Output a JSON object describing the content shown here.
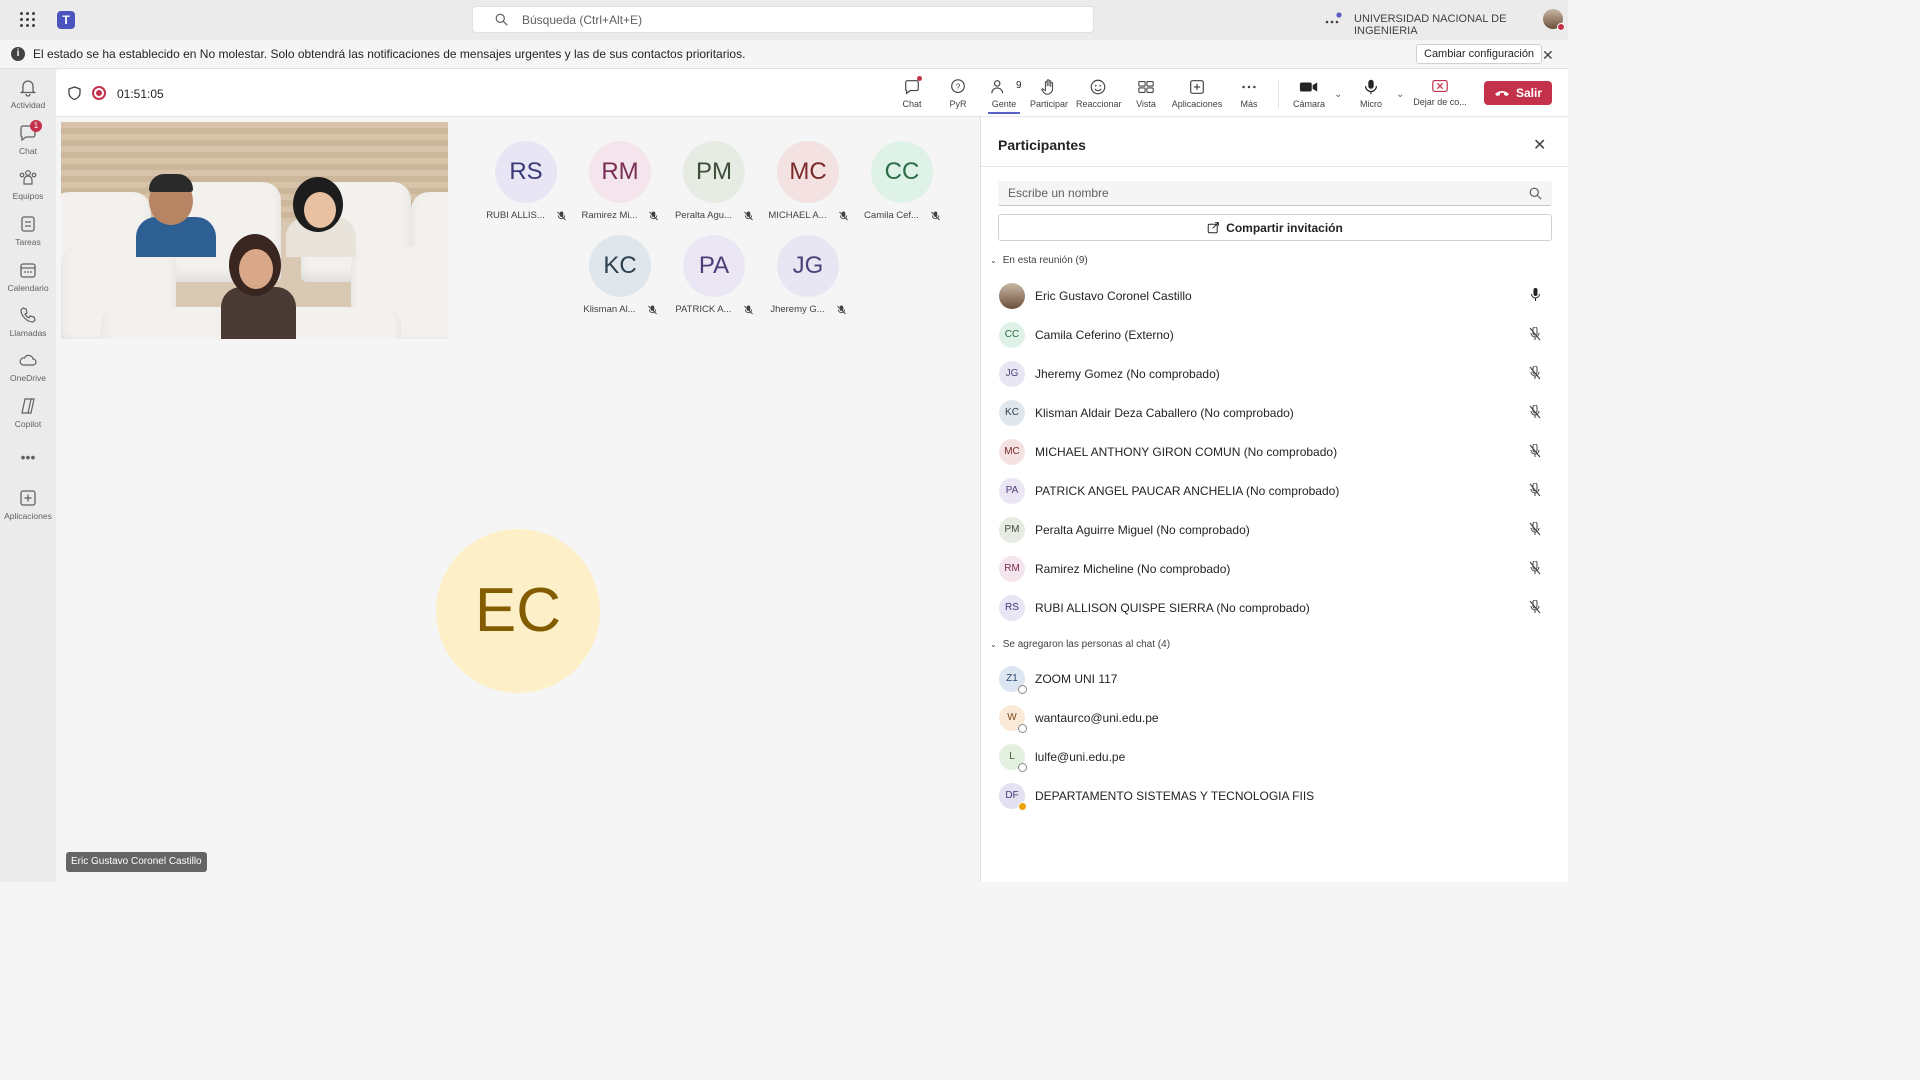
{
  "topbar": {
    "search_placeholder": "Búsqueda (Ctrl+Alt+E)",
    "org_name": "UNIVERSIDAD NACIONAL DE INGENIERIA"
  },
  "notice": {
    "message": "El estado se ha establecido en No molestar. Solo obtendrá las notificaciones de mensajes urgentes y las de sus contactos prioritarios.",
    "button": "Cambiar configuración"
  },
  "rail": {
    "items": [
      {
        "label": "Actividad",
        "icon": "bell-icon"
      },
      {
        "label": "Chat",
        "icon": "chat-icon",
        "badge": "1"
      },
      {
        "label": "Equipos",
        "icon": "teams-icon"
      },
      {
        "label": "Tareas",
        "icon": "tasks-icon"
      },
      {
        "label": "Calendario",
        "icon": "calendar-icon"
      },
      {
        "label": "Llamadas",
        "icon": "phone-icon"
      },
      {
        "label": "OneDrive",
        "icon": "cloud-icon"
      },
      {
        "label": "Copilot",
        "icon": "copilot-icon"
      },
      {
        "label": "Aplicaciones",
        "icon": "add-apps-icon"
      }
    ]
  },
  "call": {
    "timer": "01:51:05",
    "tools": {
      "chat": "Chat",
      "qa": "PyR",
      "people": "Gente",
      "people_count": "9",
      "raise": "Participar",
      "react": "Reaccionar",
      "view": "Vista",
      "apps": "Aplicaciones",
      "more": "Más",
      "camera": "Cámara",
      "mic": "Micro",
      "stop": "Dejar de co...",
      "leave": "Salir"
    }
  },
  "tiles": [
    {
      "initials": "RS",
      "name": "RUBI ALLIS...",
      "bg": "#e8e6f4",
      "fg": "#3b3a78"
    },
    {
      "initials": "RM",
      "name": "Ramirez Mi...",
      "bg": "#f4e4ec",
      "fg": "#7a2e55"
    },
    {
      "initials": "PM",
      "name": "Peralta Agu...",
      "bg": "#e6ece3",
      "fg": "#3e4d37"
    },
    {
      "initials": "MC",
      "name": "MICHAEL A...",
      "bg": "#f4e2e2",
      "fg": "#7a2a2a"
    },
    {
      "initials": "CC",
      "name": "Camila Cef...",
      "bg": "#dff2e7",
      "fg": "#2c6b48"
    },
    {
      "initials": "KC",
      "name": "Klisman Al...",
      "bg": "#dfe7ec",
      "fg": "#2c3f4d"
    },
    {
      "initials": "PA",
      "name": "PATRICK A...",
      "bg": "#ebe6f4",
      "fg": "#4c3d78"
    },
    {
      "initials": "JG",
      "name": "Jheremy G...",
      "bg": "#e9e6f4",
      "fg": "#4a4278"
    }
  ],
  "speaker": {
    "initials": "EC",
    "name": "Eric Gustavo Coronel Castillo"
  },
  "panel": {
    "title": "Participantes",
    "search_placeholder": "Escribe un nombre",
    "share_label": "Compartir invitación",
    "in_meeting_label": "En esta reunión (9)",
    "added_label": "Se agregaron las personas al chat (4)",
    "in_meeting": [
      {
        "initials": "",
        "name": "Eric Gustavo Coronel Castillo",
        "bg": "#b9a390",
        "fg": "#fff",
        "mic": "on"
      },
      {
        "initials": "CC",
        "name": "Camila Ceferino (Externo)",
        "bg": "#dff2e7",
        "fg": "#2c6b48",
        "mic": "off"
      },
      {
        "initials": "JG",
        "name": "Jheremy Gomez (No comprobado)",
        "bg": "#e9e6f4",
        "fg": "#4a4278",
        "mic": "off"
      },
      {
        "initials": "KC",
        "name": "Klisman Aldair Deza Caballero (No comprobado)",
        "bg": "#dfe7ec",
        "fg": "#2c3f4d",
        "mic": "off"
      },
      {
        "initials": "MC",
        "name": "MICHAEL ANTHONY GIRON COMUN (No comprobado)",
        "bg": "#f4e2e2",
        "fg": "#7a2a2a",
        "mic": "off"
      },
      {
        "initials": "PA",
        "name": "PATRICK ANGEL PAUCAR ANCHELIA (No comprobado)",
        "bg": "#ebe6f4",
        "fg": "#4c3d78",
        "mic": "off"
      },
      {
        "initials": "PM",
        "name": "Peralta Aguirre Miguel (No comprobado)",
        "bg": "#e6ece3",
        "fg": "#3e4d37",
        "mic": "off"
      },
      {
        "initials": "RM",
        "name": "Ramirez Micheline (No comprobado)",
        "bg": "#f4e4ec",
        "fg": "#7a2e55",
        "mic": "off"
      },
      {
        "initials": "RS",
        "name": "RUBI ALLISON QUISPE SIERRA (No comprobado)",
        "bg": "#e8e6f4",
        "fg": "#3b3a78",
        "mic": "off"
      }
    ],
    "added": [
      {
        "initials": "Z1",
        "name": "ZOOM UNI 117",
        "bg": "#dbe6f2",
        "fg": "#2c4a6b",
        "status": "offline"
      },
      {
        "initials": "W",
        "name": "wantaurco@uni.edu.pe",
        "bg": "#fbe9d8",
        "fg": "#7a4a1c",
        "status": "offline"
      },
      {
        "initials": "L",
        "name": "lulfe@uni.edu.pe",
        "bg": "#e3f0e0",
        "fg": "#3b5a33",
        "status": "offline"
      },
      {
        "initials": "DF",
        "name": "DEPARTAMENTO SISTEMAS Y TECNOLOGIA FIIS",
        "bg": "#e4e2f2",
        "fg": "#3f3a78",
        "status": "away"
      }
    ]
  }
}
